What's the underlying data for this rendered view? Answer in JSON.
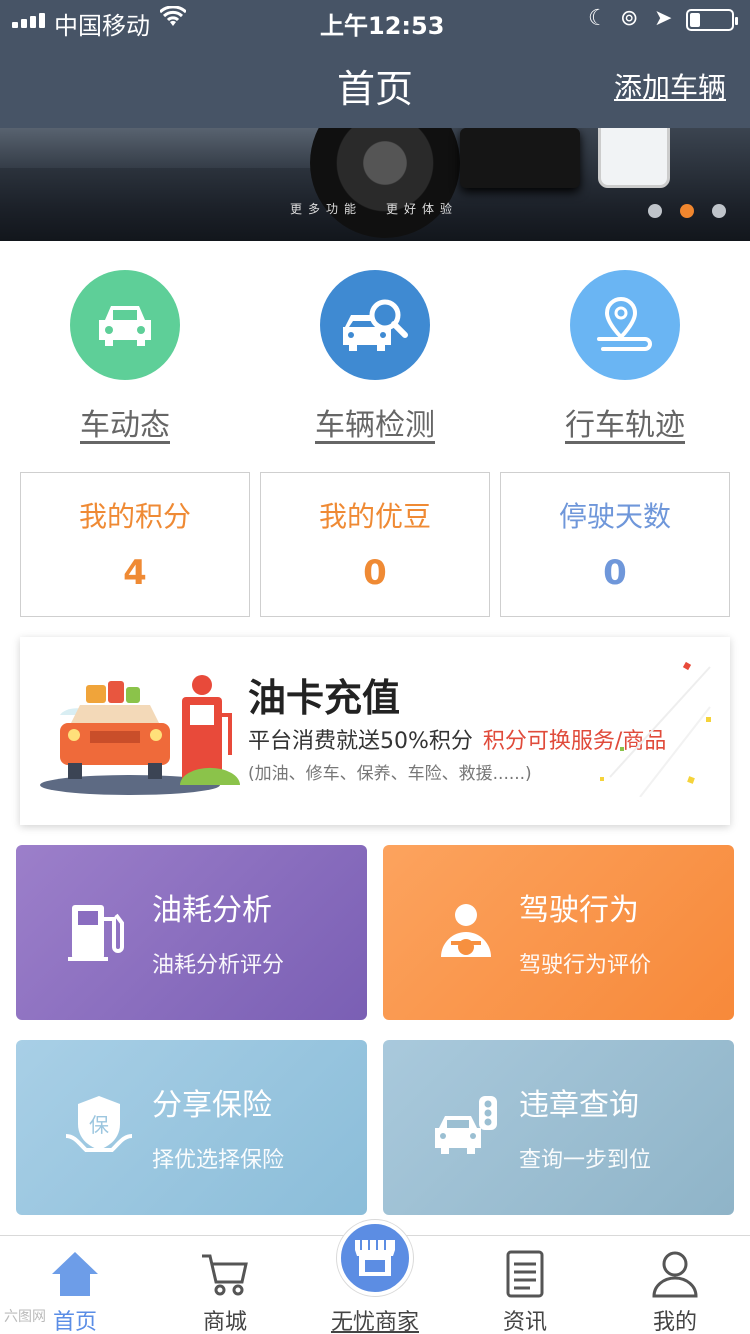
{
  "status": {
    "carrier": "中国移动",
    "time": "上午12:53"
  },
  "nav": {
    "title": "首页",
    "add_vehicle": "添加车辆"
  },
  "banner": {
    "slogan_1": "更多功能",
    "slogan_2": "更好体验",
    "page_count": 3,
    "active_page": 2
  },
  "quick_actions": [
    {
      "label": "车动态",
      "icon": "car-icon",
      "color": "#5ecf98"
    },
    {
      "label": "车辆检测",
      "icon": "car-search-icon",
      "color": "#3f8ad2"
    },
    {
      "label": "行车轨迹",
      "icon": "location-route-icon",
      "color": "#6ab5f3"
    }
  ],
  "stats": [
    {
      "title": "我的积分",
      "value": "4",
      "color": "#ef8a34"
    },
    {
      "title": "我的优豆",
      "value": "0",
      "color": "#ef8a34"
    },
    {
      "title": "停驶天数",
      "value": "0",
      "color": "#6f97da"
    }
  ],
  "oil_card": {
    "title": "油卡充值",
    "desc": "平台消费就送50%积分",
    "highlight": "积分可换服务/商品",
    "note": "(加油、修车、保养、车险、救援......)"
  },
  "services": [
    {
      "title": "油耗分析",
      "subtitle": "油耗分析评分",
      "icon": "fuel-pump-icon",
      "color_from": "#9c7fca",
      "color_to": "#7a5fb4"
    },
    {
      "title": "驾驶行为",
      "subtitle": "驾驶行为评价",
      "icon": "driver-icon",
      "color_from": "#fca35e",
      "color_to": "#f7893a"
    },
    {
      "title": "分享保险",
      "subtitle": "择优选择保险",
      "icon": "insurance-shield-icon",
      "color_from": "#a8cfe6",
      "color_to": "#8bbdd9"
    },
    {
      "title": "违章查询",
      "subtitle": "查询一步到位",
      "icon": "traffic-violation-icon",
      "color_from": "#a9c9dc",
      "color_to": "#8fb4c8"
    }
  ],
  "tabs": [
    {
      "label": "首页",
      "icon": "home-icon"
    },
    {
      "label": "商城",
      "icon": "cart-icon"
    },
    {
      "label": "无忧商家",
      "icon": "store-icon"
    },
    {
      "label": "资讯",
      "icon": "news-icon"
    },
    {
      "label": "我的",
      "icon": "user-icon"
    }
  ],
  "active_tab": 0,
  "watermark": "六图网"
}
